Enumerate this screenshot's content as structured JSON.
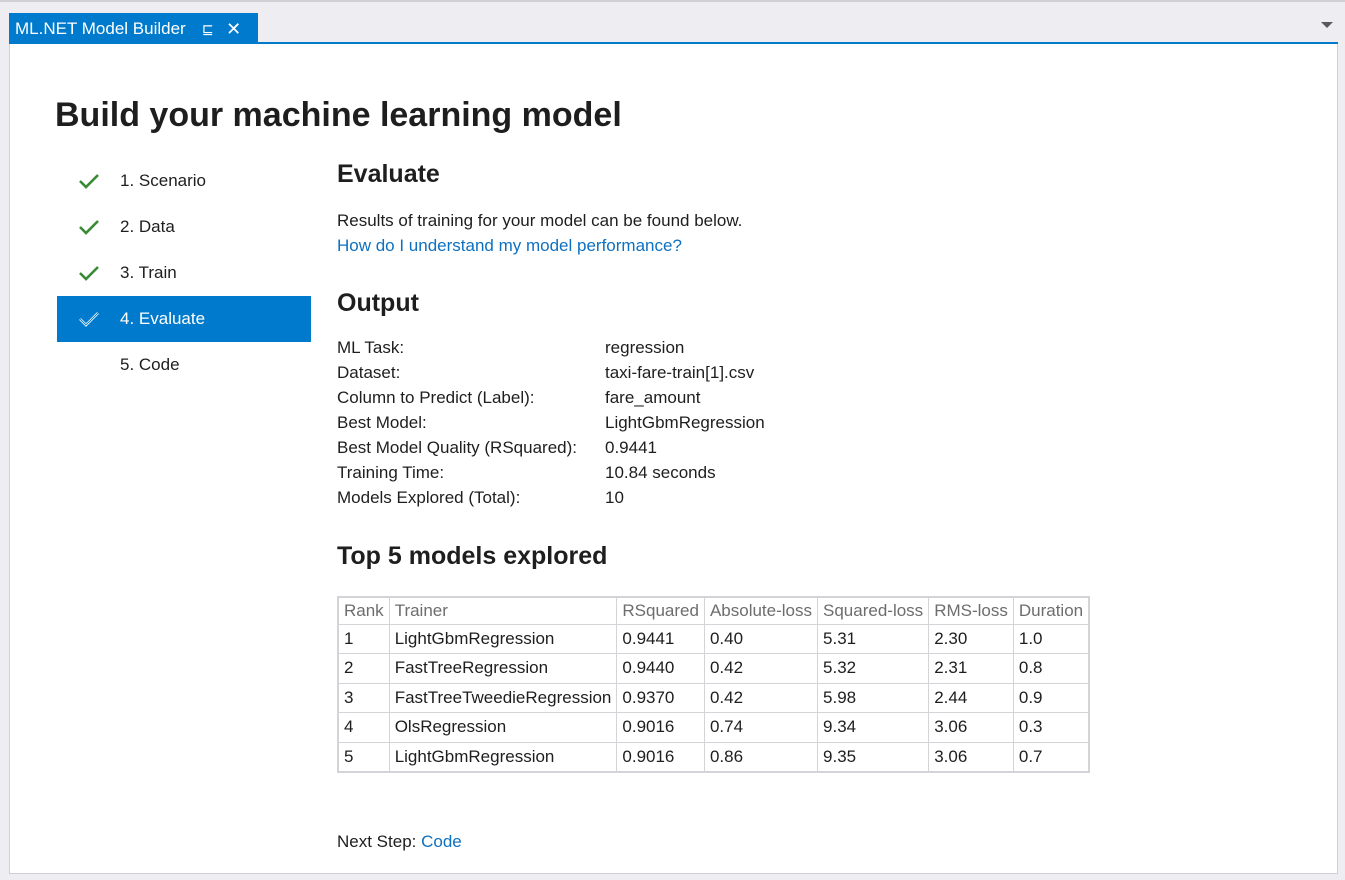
{
  "tab": {
    "title": "ML.NET Model Builder",
    "pin_icon": "pin-icon",
    "close_icon": "close-icon"
  },
  "page": {
    "title": "Build your machine learning model"
  },
  "steps": [
    {
      "label": "1. Scenario",
      "done": true
    },
    {
      "label": "2. Data",
      "done": true
    },
    {
      "label": "3. Train",
      "done": true
    },
    {
      "label": "4. Evaluate",
      "done": true,
      "active": true
    },
    {
      "label": "5. Code",
      "done": false
    }
  ],
  "evaluate": {
    "heading": "Evaluate",
    "description": "Results of training for your model can be found below.",
    "help_link": "How do I understand my model performance?"
  },
  "output": {
    "heading": "Output",
    "rows": [
      {
        "key": "ML Task:",
        "value": "regression"
      },
      {
        "key": "Dataset:",
        "value": "taxi-fare-train[1].csv"
      },
      {
        "key": "Column to Predict (Label):",
        "value": "fare_amount"
      },
      {
        "key": "Best Model:",
        "value": "LightGbmRegression"
      },
      {
        "key": "Best Model Quality (RSquared):",
        "value": "0.9441"
      },
      {
        "key": "Training Time:",
        "value": "10.84 seconds"
      },
      {
        "key": "Models Explored (Total):",
        "value": "10"
      }
    ]
  },
  "top_models": {
    "heading": "Top 5 models explored",
    "columns": [
      "Rank",
      "Trainer",
      "RSquared",
      "Absolute-loss",
      "Squared-loss",
      "RMS-loss",
      "Duration"
    ],
    "rows": [
      [
        "1",
        "LightGbmRegression",
        "0.9441",
        "0.40",
        "5.31",
        "2.30",
        "1.0"
      ],
      [
        "2",
        "FastTreeRegression",
        "0.9440",
        "0.42",
        "5.32",
        "2.31",
        "0.8"
      ],
      [
        "3",
        "FastTreeTweedieRegression",
        "0.9370",
        "0.42",
        "5.98",
        "2.44",
        "0.9"
      ],
      [
        "4",
        "OlsRegression",
        "0.9016",
        "0.74",
        "9.34",
        "3.06",
        "0.3"
      ],
      [
        "5",
        "LightGbmRegression",
        "0.9016",
        "0.86",
        "9.35",
        "3.06",
        "0.7"
      ]
    ]
  },
  "next_step": {
    "label": "Next Step:",
    "link": "Code"
  },
  "colors": {
    "accent": "#007acc",
    "check_green": "#388a34",
    "link": "#0e70c0"
  }
}
